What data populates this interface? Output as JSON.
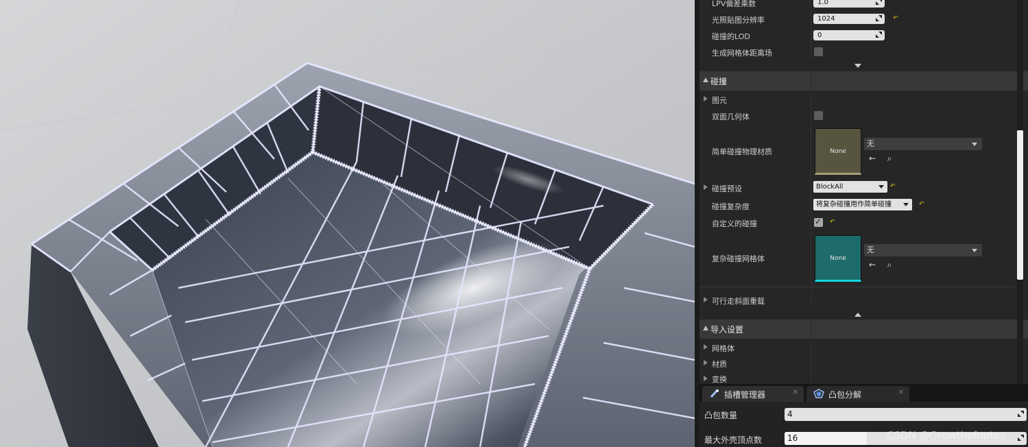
{
  "details": {
    "rows_top": [
      {
        "label": "LPV偏差乘数",
        "value": "1.0"
      },
      {
        "label": "光照贴图分辨率",
        "value": "1024"
      },
      {
        "label": "碰撞的LOD",
        "value": "0"
      },
      {
        "label": "生成网格体距离场",
        "checked": false
      }
    ],
    "collision": {
      "title": "碰撞",
      "primitives": "图元",
      "double_sided": "双面几何体",
      "simple_material_label": "简单碰撞物理材质",
      "simple_material_thumb": "None",
      "simple_material_value": "无",
      "preset_label": "碰撞预设",
      "preset_value": "BlockAll",
      "complexity_label": "碰撞复杂度",
      "complexity_value": "将复杂碰撞用作简单碰撞",
      "customized_label": "自定义的碰撞",
      "customized_checked": true,
      "complex_mesh_label": "复杂碰撞网格体",
      "complex_mesh_thumb": "None",
      "complex_mesh_value": "无",
      "walkable_label": "可行走斜面重载"
    },
    "import": {
      "title": "导入设置",
      "items": [
        "网格体",
        "材质",
        "变换"
      ]
    }
  },
  "tabs": [
    {
      "label": "插槽管理器",
      "icon": "socket-manager-icon"
    },
    {
      "label": "凸包分解",
      "icon": "convex-decomposition-icon"
    }
  ],
  "convex": {
    "hull_count_label": "凸包数量",
    "hull_count_value": "4",
    "max_verts_label": "最大外壳顶点数",
    "max_verts_value": "16",
    "max_verts_fill": 0.34
  },
  "watermark": "CSDN @Growthofnotes",
  "colors": {
    "accent_reset": "#d5c01a",
    "thumb_simple": "#57543f",
    "thumb_complex": "#1d6b6a",
    "wire": "#e6e6ff"
  }
}
